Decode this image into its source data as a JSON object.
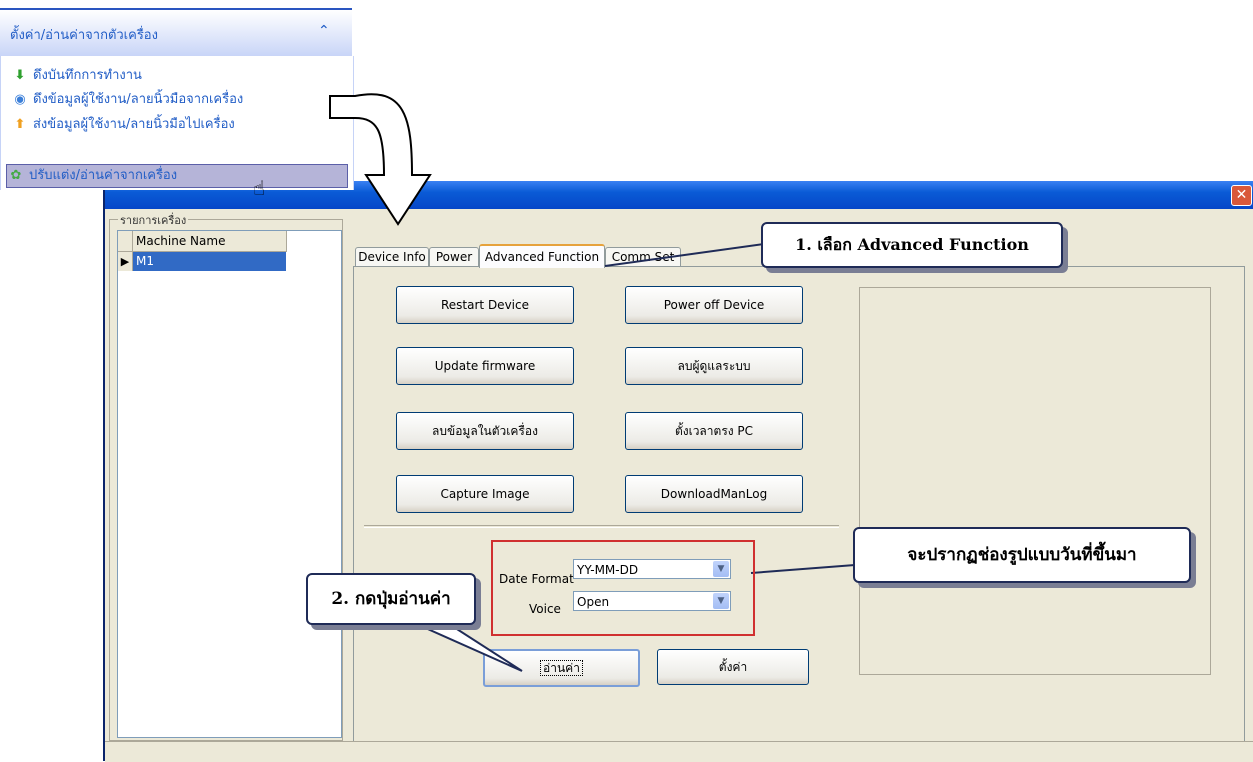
{
  "menu": {
    "header_title": "ตั้งค่า/อ่านค่าจากตัวเครื่อง",
    "collapse_icon": "double-chevron-up-icon",
    "items": [
      {
        "label": "ดึงบันทึกการทำงาน",
        "icon": "download-arrow-icon",
        "icon_color": "#2ea02e"
      },
      {
        "label": "ดึงข้อมูลผู้ใช้งาน/ลายนิ้วมือจากเครื่อง",
        "icon": "download-circle-icon",
        "icon_color": "#3b7fd9"
      },
      {
        "label": "ส่งข้อมูลผู้ใช้งาน/ลายนิ้วมือไปเครื่อง",
        "icon": "upload-arrow-icon",
        "icon_color": "#f0a020"
      },
      {
        "label": "ปรับแต่ง/อ่านค่าจากเครื่อง",
        "icon": "settings-cluster-icon",
        "icon_color": "#44aa44",
        "selected": true
      }
    ]
  },
  "dialog": {
    "close_label": "✕",
    "machine_list": {
      "legend": "รายการเครื่อง",
      "column_header": "Machine Name",
      "rows": [
        {
          "indicator": "▶",
          "name": "M1"
        }
      ]
    },
    "tabs": [
      {
        "label": "Device Info"
      },
      {
        "label": "Power"
      },
      {
        "label": "Advanced Function",
        "active": true
      },
      {
        "label": "Comm Set"
      }
    ],
    "advanced": {
      "buttons": [
        "Restart Device",
        "Power off Device",
        "Update firmware",
        "ลบผู้ดูแลระบบ",
        "ลบข้อมูลในตัวเครื่อง",
        "ตั้งเวลาตรง PC",
        "Capture Image",
        "DownloadManLog"
      ],
      "date_format_label": "Date Format",
      "date_format_value": "YY-MM-DD",
      "voice_label": "Voice",
      "voice_value": "Open",
      "read_button": "อ่านค่า",
      "set_button": "ตั้งค่า"
    }
  },
  "annotations": {
    "callout_1": "1. เลือก Advanced Function",
    "callout_2": "2. กดปุ่มอ่านค่า",
    "callout_3": "จะปรากฏช่องรูปแบบวันที่ขึ้นมา",
    "accent_red": "#d03030",
    "callout_border": "#1f2b57"
  }
}
